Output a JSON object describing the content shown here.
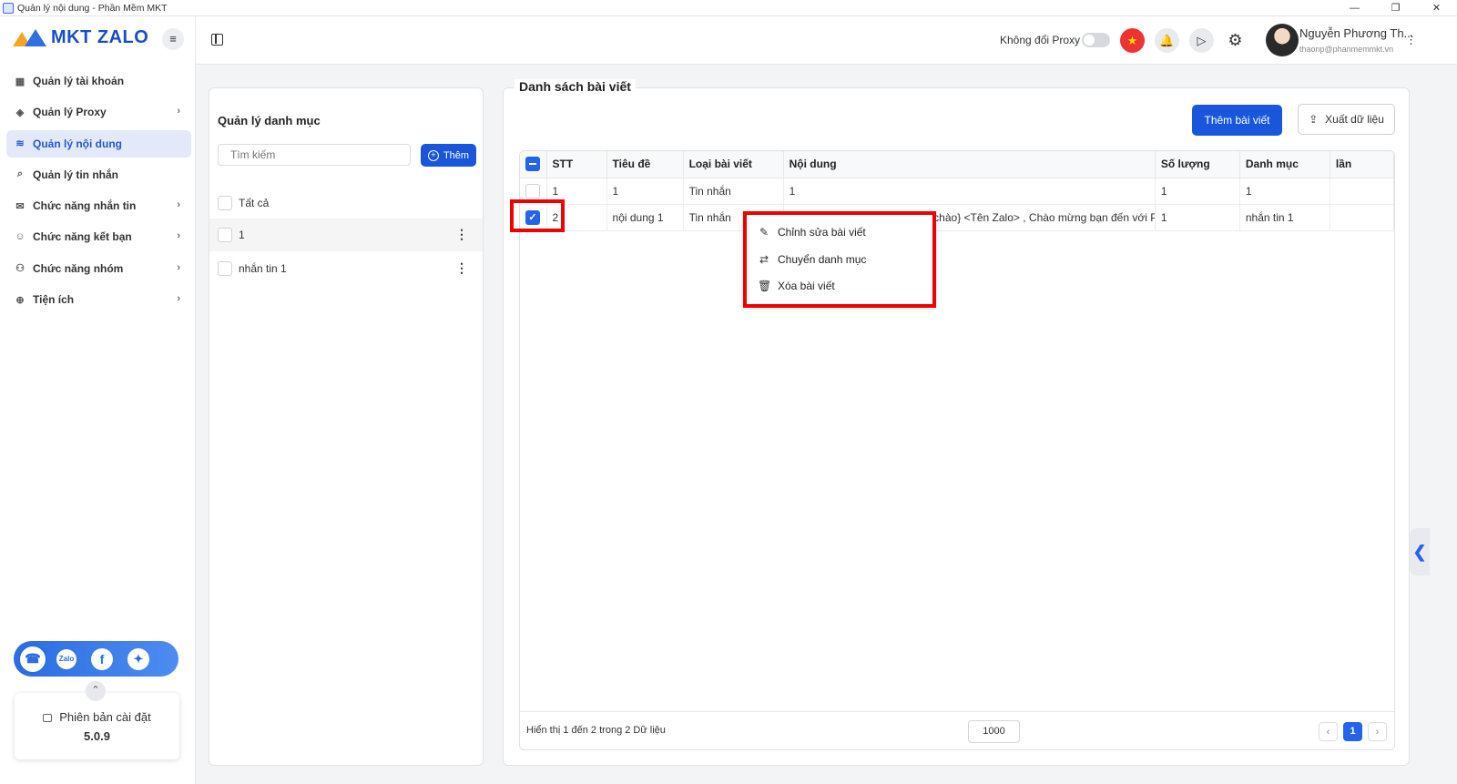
{
  "window": {
    "title": "Quản lý nội dung - Phần Mềm MKT",
    "controls": [
      "—",
      "❐",
      "✕"
    ]
  },
  "sidebar": {
    "logo_text": "MKT ZALO",
    "menu_icon": "≡",
    "items": [
      {
        "label": "Quản lý tài khoản",
        "icon": "grid-icon",
        "glyph": "▦",
        "has_chevron": false,
        "active": false
      },
      {
        "label": "Quản lý Proxy",
        "icon": "layers-icon",
        "glyph": "◈",
        "has_chevron": true,
        "active": false
      },
      {
        "label": "Quản lý nội dung",
        "icon": "sliders-icon",
        "glyph": "≋",
        "has_chevron": false,
        "active": true
      },
      {
        "label": "Quản lý tin nhắn",
        "icon": "search-message-icon",
        "glyph": "⌕",
        "has_chevron": false,
        "active": false
      },
      {
        "label": "Chức năng nhắn tin",
        "icon": "chat-icon",
        "glyph": "✉",
        "has_chevron": true,
        "active": false
      },
      {
        "label": "Chức năng kết bạn",
        "icon": "add-friend-icon",
        "glyph": "☺",
        "has_chevron": true,
        "active": false
      },
      {
        "label": "Chức năng nhóm",
        "icon": "group-icon",
        "glyph": "⚇",
        "has_chevron": true,
        "active": false
      },
      {
        "label": "Tiện ích",
        "icon": "utility-icon",
        "glyph": "⊕",
        "has_chevron": true,
        "active": false
      }
    ],
    "chevron": "›",
    "social": {
      "support_glyph": "☎",
      "zalo_label": "Zalo",
      "facebook_glyph": "f",
      "globe_glyph": "✦"
    },
    "collapse_glyph": "⌃",
    "version_label": "Phiên bản cài đặt",
    "version_number": "5.0.9"
  },
  "header": {
    "proxy_label": "Không đổi Proxy",
    "proxy_enabled": false,
    "flag_glyph": "★",
    "bell_glyph": "🔔",
    "play_glyph": "▷",
    "gear_glyph": "⚙",
    "user_name": "Nguyễn Phương Th...",
    "user_email": "thaonp@phanmemmkt.vn",
    "more_glyph": "⋮"
  },
  "category_panel": {
    "title": "Quản lý danh mục",
    "search_placeholder": "Tìm kiếm",
    "add_label": "Thêm",
    "add_glyph": "+",
    "rows": [
      {
        "label": "Tất cả",
        "has_menu": false
      },
      {
        "label": "1",
        "has_menu": true
      },
      {
        "label": "nhắn tin 1",
        "has_menu": true
      }
    ],
    "kebab_glyph": "⋮"
  },
  "post_panel": {
    "title": "Danh sách bài viết",
    "add_post_label": "Thêm bài viết",
    "export_label": "Xuất dữ liệu",
    "export_glyph": "⇪",
    "columns": [
      "STT",
      "Tiêu đề",
      "Loại bài viết",
      "Nội dung",
      "Số lượng",
      "Danh mục",
      "lần"
    ],
    "rows": [
      {
        "stt": "1",
        "title": "1",
        "type": "Tin nhắn",
        "content": "1",
        "count": "1",
        "category": "1",
        "times": "",
        "checked": false
      },
      {
        "stt": "2",
        "title": "nội dung 1",
        "type": "Tin nhắn",
        "content": "{Xin chào|Chào|Hi|Hello|Kính chào} <Tên Zalo> , Chào mừng bạn đến với Ph...",
        "count": "1",
        "category": "nhắn tin 1",
        "times": "",
        "checked": true
      }
    ],
    "check_glyph": "✓",
    "footer_info": "Hiển thị 1 đến 2 trong 2 Dữ liệu",
    "page_size": "1000",
    "prev_glyph": "‹",
    "next_glyph": "›",
    "current_page": "1"
  },
  "context_menu": {
    "items": [
      {
        "label": "Chỉnh sửa bài viết",
        "icon": "edit-icon",
        "glyph": "✎"
      },
      {
        "label": "Chuyển danh mục",
        "icon": "move-icon",
        "glyph": "⇄"
      },
      {
        "label": "Xóa bài viết",
        "icon": "trash-icon",
        "glyph": "🗑"
      }
    ]
  },
  "side_tab_glyph": "❮",
  "colors": {
    "primary": "#1a56db",
    "highlight": "#ee0000",
    "active_bg": "#e3e9f9"
  }
}
